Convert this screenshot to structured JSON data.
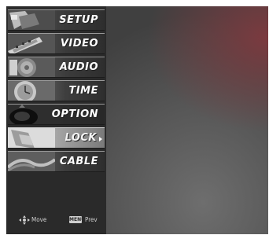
{
  "menu": {
    "items": [
      {
        "label": "SETUP",
        "icon": "setup-thumbnail-icon"
      },
      {
        "label": "VIDEO",
        "icon": "video-thumbnail-icon"
      },
      {
        "label": "AUDIO",
        "icon": "audio-thumbnail-icon"
      },
      {
        "label": "TIME",
        "icon": "time-thumbnail-icon"
      },
      {
        "label": "OPTION",
        "icon": "option-thumbnail-icon"
      },
      {
        "label": "LOCK",
        "icon": "lock-thumbnail-icon",
        "selected": true
      },
      {
        "label": "CABLE",
        "icon": "cable-thumbnail-icon"
      }
    ],
    "selected_index": 5
  },
  "footer": {
    "move_label": "Move",
    "prev_label": "Prev",
    "menu_key_label": "MENU",
    "move_icon": "dpad-navigation-icon"
  },
  "colors": {
    "menu_background": "#2a2a2a",
    "label_text": "#ffffff",
    "background_accent": "#7b3a3f"
  }
}
